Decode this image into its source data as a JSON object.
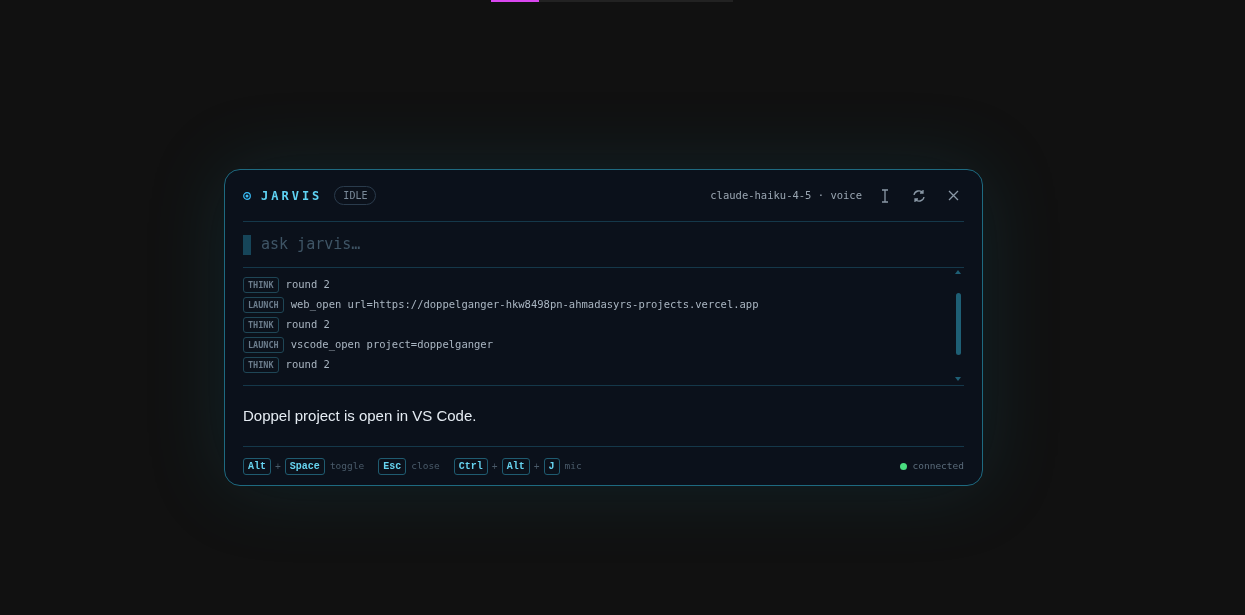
{
  "progress": {
    "level": 0.2
  },
  "header": {
    "title": "JARVIS",
    "status": "IDLE",
    "model": "claude-haiku-4-5 · voice"
  },
  "input": {
    "placeholder": "ask jarvis…"
  },
  "log": [
    {
      "tag": "THINK",
      "text": "round 2"
    },
    {
      "tag": "LAUNCH",
      "text": "web_open url=https://doppelganger-hkw8498pn-ahmadasyrs-projects.vercel.app"
    },
    {
      "tag": "THINK",
      "text": "round 2"
    },
    {
      "tag": "LAUNCH",
      "text": "vscode_open project=doppelganger"
    },
    {
      "tag": "THINK",
      "text": "round 2"
    }
  ],
  "response": "Doppel project is open in VS Code.",
  "shortcuts": [
    {
      "keys": [
        "Alt",
        "+",
        "Space"
      ],
      "label": "toggle"
    },
    {
      "keys": [
        "Esc"
      ],
      "label": "close"
    },
    {
      "keys": [
        "Ctrl",
        "+",
        "Alt",
        "+",
        "J"
      ],
      "label": "mic"
    }
  ],
  "connection": {
    "label": "connected",
    "color": "#4ade80"
  }
}
